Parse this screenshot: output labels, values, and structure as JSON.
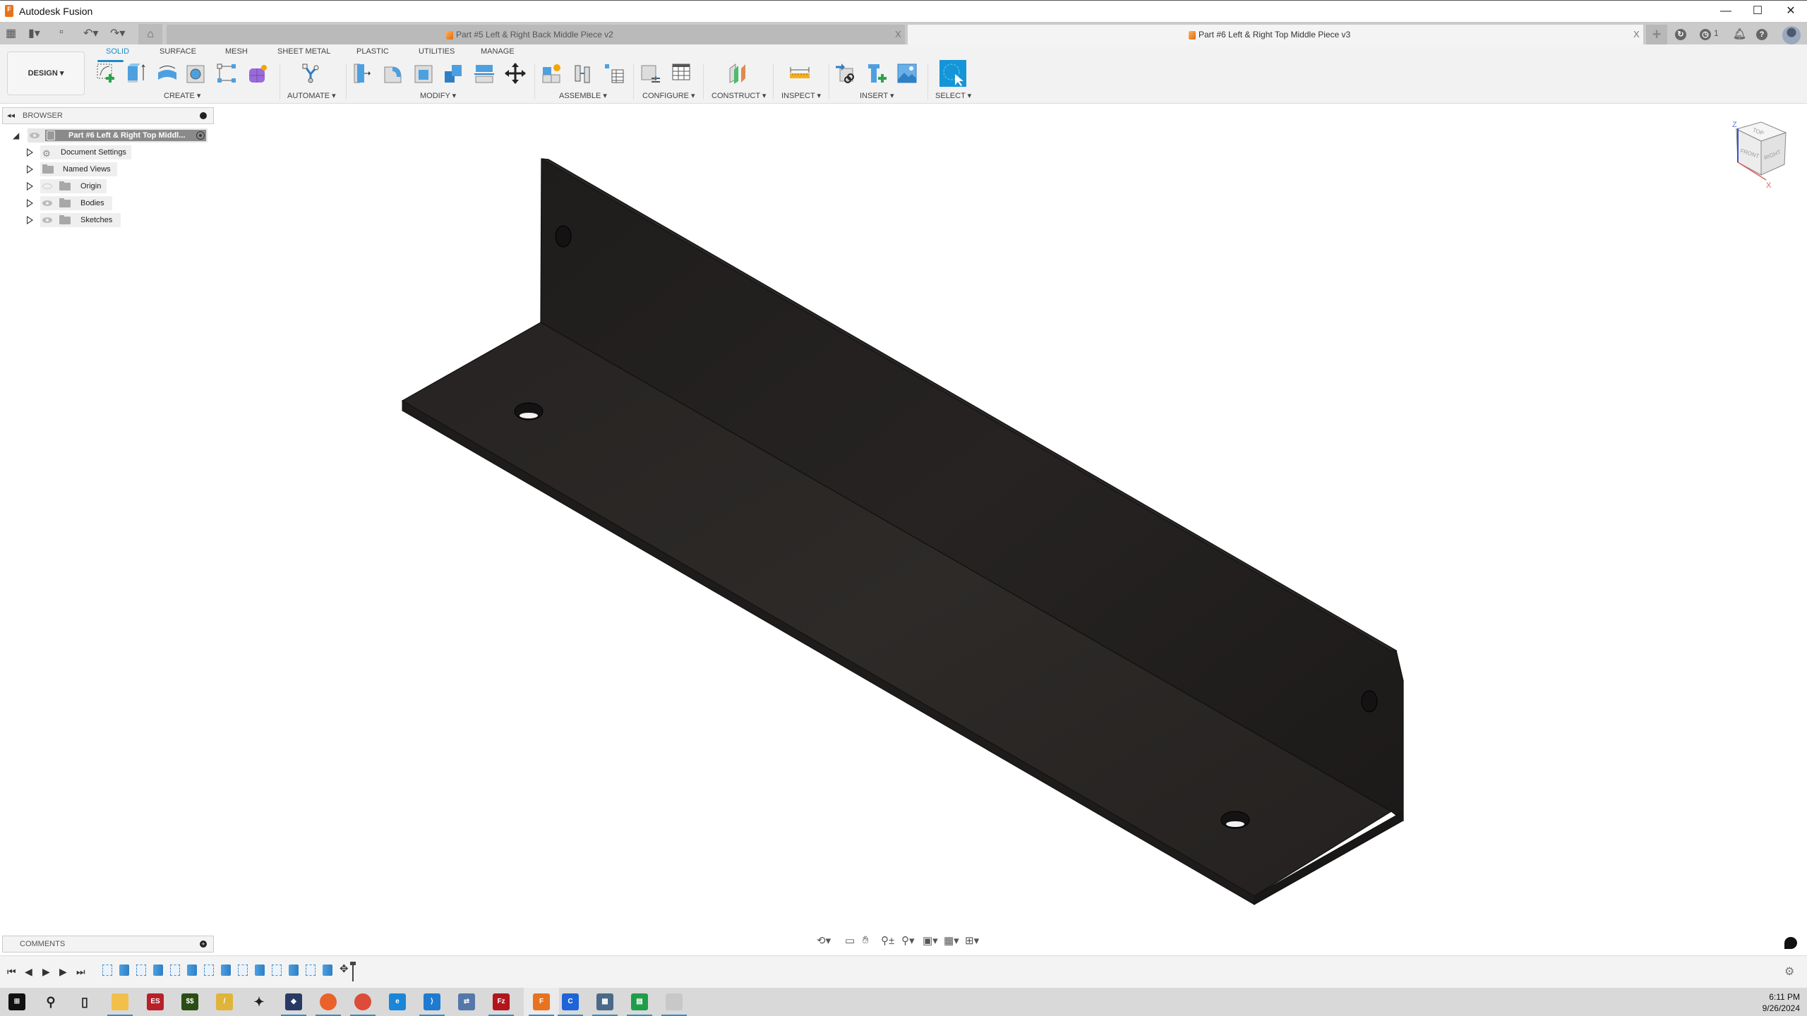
{
  "window": {
    "app_title": "Autodesk Fusion",
    "controls": {
      "minimize": "—",
      "maximize": "☐",
      "close": "✕"
    }
  },
  "tabbar": {
    "tabs": [
      {
        "label": "Part #5 Left & Right Back Middle Piece v2",
        "active": false
      },
      {
        "label": "Part #6 Left & Right Top Middle Piece v3",
        "active": true
      }
    ],
    "close_glyph": "X",
    "jobs_count": "1",
    "icons": [
      "grid-menu-icon",
      "file-icon",
      "save-icon",
      "undo-icon",
      "redo-icon",
      "home-icon",
      "new-tab-icon",
      "sync-icon",
      "job-status-icon",
      "notifications-icon",
      "help-icon",
      "user-avatar"
    ]
  },
  "ribbon": {
    "workspace": "DESIGN",
    "tabs": [
      "SOLID",
      "SURFACE",
      "MESH",
      "SHEET METAL",
      "PLASTIC",
      "UTILITIES",
      "MANAGE"
    ],
    "active_tab": "SOLID",
    "groups": [
      {
        "label": "CREATE",
        "tools": [
          "create-sketch",
          "extrude",
          "revolve",
          "hole",
          "rectangular-pattern",
          "create-form"
        ]
      },
      {
        "label": "AUTOMATE",
        "tools": [
          "automate"
        ]
      },
      {
        "label": "MODIFY",
        "tools": [
          "press-pull",
          "fillet",
          "shell",
          "combine",
          "offset-face",
          "move-copy"
        ]
      },
      {
        "label": "ASSEMBLE",
        "tools": [
          "new-component",
          "joint",
          "bill-of-materials"
        ]
      },
      {
        "label": "CONFIGURE",
        "tools": [
          "configure",
          "configuration-table"
        ]
      },
      {
        "label": "CONSTRUCT",
        "tools": [
          "offset-plane"
        ]
      },
      {
        "label": "INSPECT",
        "tools": [
          "measure"
        ]
      },
      {
        "label": "INSERT",
        "tools": [
          "insert-derive",
          "insert-mcmaster",
          "insert-canvas"
        ]
      },
      {
        "label": "SELECT",
        "tools": [
          "select"
        ]
      }
    ]
  },
  "browser": {
    "title": "BROWSER",
    "root": "Part #6 Left & Right Top Middl...",
    "items": [
      {
        "label": "Document Settings",
        "icon": "gear-icon",
        "visible": null
      },
      {
        "label": "Named Views",
        "icon": "folder-icon",
        "visible": null
      },
      {
        "label": "Origin",
        "icon": "folder-icon",
        "visible": false
      },
      {
        "label": "Bodies",
        "icon": "folder-icon",
        "visible": true
      },
      {
        "label": "Sketches",
        "icon": "folder-icon",
        "visible": true
      }
    ]
  },
  "viewcube": {
    "top": "TOP",
    "front": "FRONT",
    "right": "RIGHT",
    "axis_z": "Z",
    "axis_x": "X"
  },
  "comments": {
    "title": "COMMENTS"
  },
  "timeline": {
    "controls": [
      "first",
      "previous",
      "play",
      "next",
      "last"
    ],
    "features": [
      "sketch",
      "extrude",
      "sketch",
      "extrude",
      "sketch",
      "extrude",
      "sketch",
      "extrude",
      "sketch",
      "extrude",
      "sketch",
      "extrude",
      "sketch",
      "extrude",
      "move"
    ]
  },
  "nav_toolbar": [
    "orbit",
    "look-at",
    "pan",
    "zoom",
    "fit",
    "display-settings",
    "grid-snaps",
    "viewports"
  ],
  "taskbar": {
    "apps": [
      "start",
      "search",
      "task-view",
      "file-explorer",
      "es-app",
      "ss-app",
      "pen-app",
      "game-app",
      "virtualbox",
      "firefox",
      "chrome",
      "edge",
      "vscode",
      "network-app",
      "filezilla",
      "fusion",
      "c-app",
      "calculator",
      "sheets-app",
      "misc-app"
    ],
    "time": "6:11 PM",
    "date": "9/26/2024"
  },
  "colors": {
    "accent": "#1b8ac9",
    "model_body": "#2a2726",
    "fusion_orange": "#e8731e"
  }
}
